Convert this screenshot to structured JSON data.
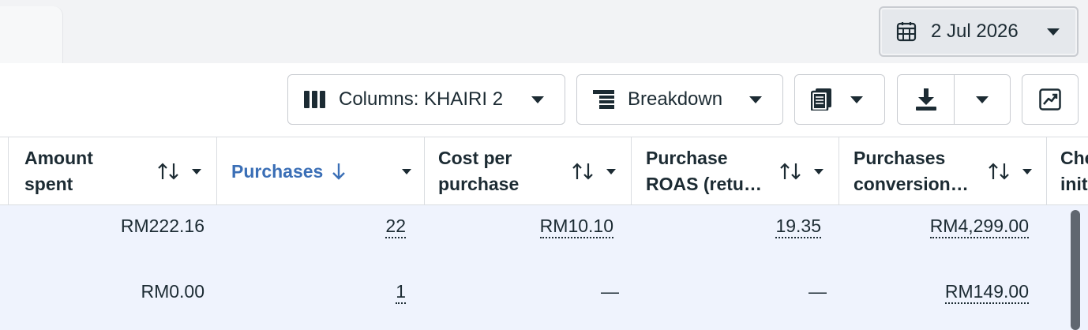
{
  "date_picker": {
    "label": "2 Jul 2026",
    "icon": "calendar-icon"
  },
  "toolbar": {
    "columns_label": "Columns: KHAIRI 2",
    "breakdown_label": "Breakdown",
    "reports_icon": "reports-icon",
    "export_icon": "download-icon",
    "chart_icon": "chart-icon"
  },
  "columns": [
    {
      "label_line1": "Amount",
      "label_line2": "spent",
      "sort": "none"
    },
    {
      "label_line1": "Purchases",
      "label_line2": "",
      "sort": "descending"
    },
    {
      "label_line1": "Cost per",
      "label_line2": "purchase",
      "sort": "none"
    },
    {
      "label_line1": "Purchase",
      "label_line2": "ROAS (retu…",
      "sort": "none"
    },
    {
      "label_line1": "Purchases",
      "label_line2": "conversion…",
      "sort": "none"
    },
    {
      "label_line1": "Che",
      "label_line2": "initi",
      "sort": "none"
    }
  ],
  "rows": [
    {
      "amount_spent": "RM222.16",
      "purchases": "22",
      "cost_per_purchase": "RM10.10",
      "purchase_roas": "19.35",
      "purchases_conversion": "RM4,299.00"
    },
    {
      "amount_spent": "RM0.00",
      "purchases": "1",
      "cost_per_purchase": "—",
      "purchase_roas": "—",
      "purchases_conversion": "RM149.00"
    }
  ],
  "colors": {
    "accent": "#3b6fb6",
    "row_bg": "#eff3fd",
    "text": "#1c2b33"
  }
}
